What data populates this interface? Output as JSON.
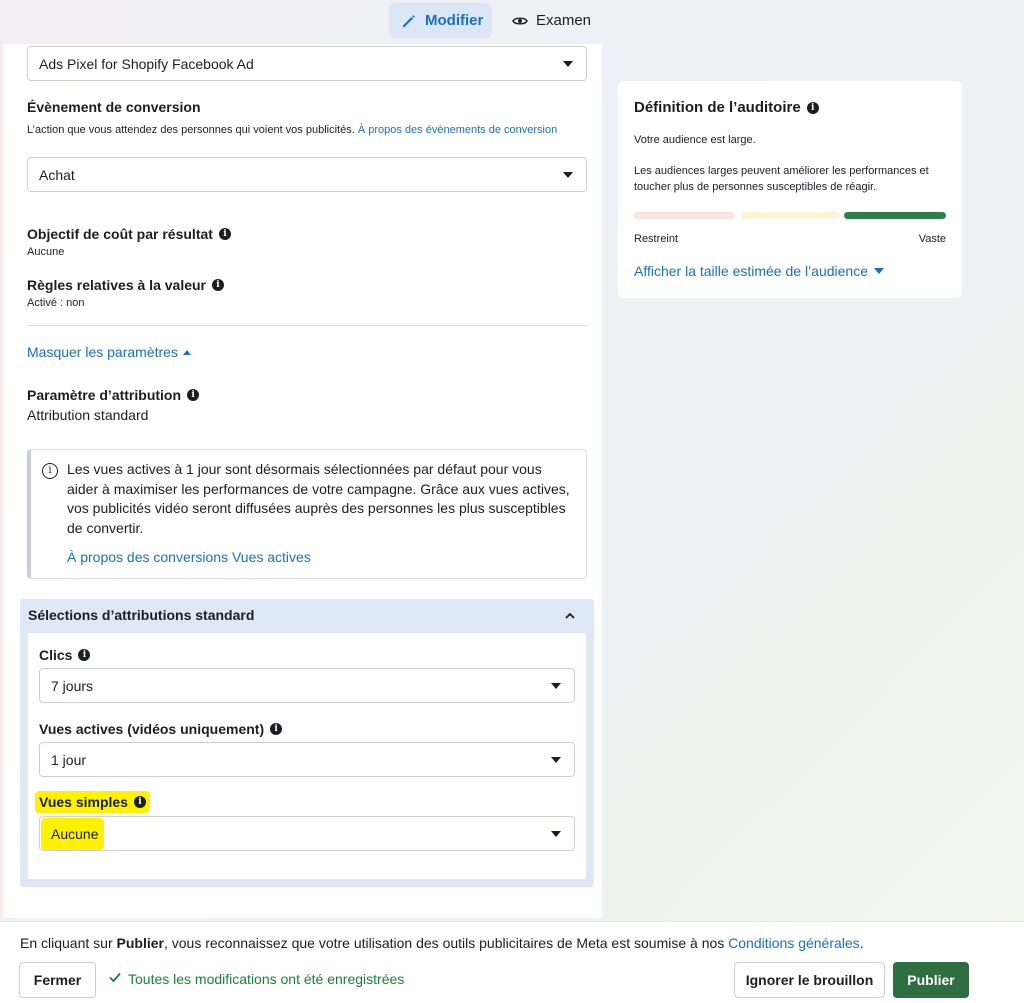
{
  "tabs": {
    "edit_label": "Modifier",
    "review_label": "Examen"
  },
  "pixel_select": {
    "value": "Ads Pixel for Shopify Facebook Ad"
  },
  "conversion_event": {
    "label": "Évènement de conversion",
    "description": "L’action que vous attendez des personnes qui voient vos publicités.",
    "link": "À propos des évènements de conversion",
    "value": "Achat"
  },
  "cost_goal": {
    "label": "Objectif de coût par résultat",
    "value": "Aucune"
  },
  "value_rules": {
    "label": "Règles relatives à la valeur",
    "value": "Activé : non"
  },
  "hide_params_label": "Masquer les paramètres",
  "attribution_setting": {
    "label": "Paramètre d’attribution",
    "value": "Attribution standard"
  },
  "callout": {
    "text": "Les vues actives à 1 jour sont désormais sélectionnées par défaut pour vous aider à maximiser les performances de votre campagne. Grâce aux vues actives, vos publicités vidéo seront diffusées auprès des personnes les plus susceptibles de convertir.",
    "link": "À propos des conversions Vues actives"
  },
  "attribution_panel": {
    "title": "Sélections d’attributions standard",
    "clicks": {
      "label": "Clics",
      "value": "7 jours"
    },
    "engaged_views": {
      "label": "Vues actives (vidéos uniquement)",
      "value": "1 jour"
    },
    "simple_views": {
      "label": "Vues simples",
      "value": "Aucune"
    }
  },
  "audience_card": {
    "title": "Définition de l’auditoire",
    "status": "Votre audience est large.",
    "description": "Les audiences larges peuvent améliorer les performances et toucher plus de personnes susceptibles de réagir.",
    "meter_low": "Restreint",
    "meter_high": "Vaste",
    "meter_level": "Vaste",
    "meter_colors": [
      "#fbe3e4",
      "#fdf5d9",
      "#2e7d4f"
    ],
    "link": "Afficher la taille estimée de l’audience"
  },
  "footer": {
    "terms_prefix": "En cliquant sur ",
    "terms_bold": "Publier",
    "terms_middle": ", vous reconnaissez que votre utilisation des outils publicitaires de Meta est soumise à nos ",
    "terms_link": "Conditions générales",
    "terms_suffix": ".",
    "close_label": "Fermer",
    "saved_status": "Toutes les modifications ont été enregistrées",
    "ignore_label": "Ignorer le brouillon",
    "publish_label": "Publier"
  }
}
